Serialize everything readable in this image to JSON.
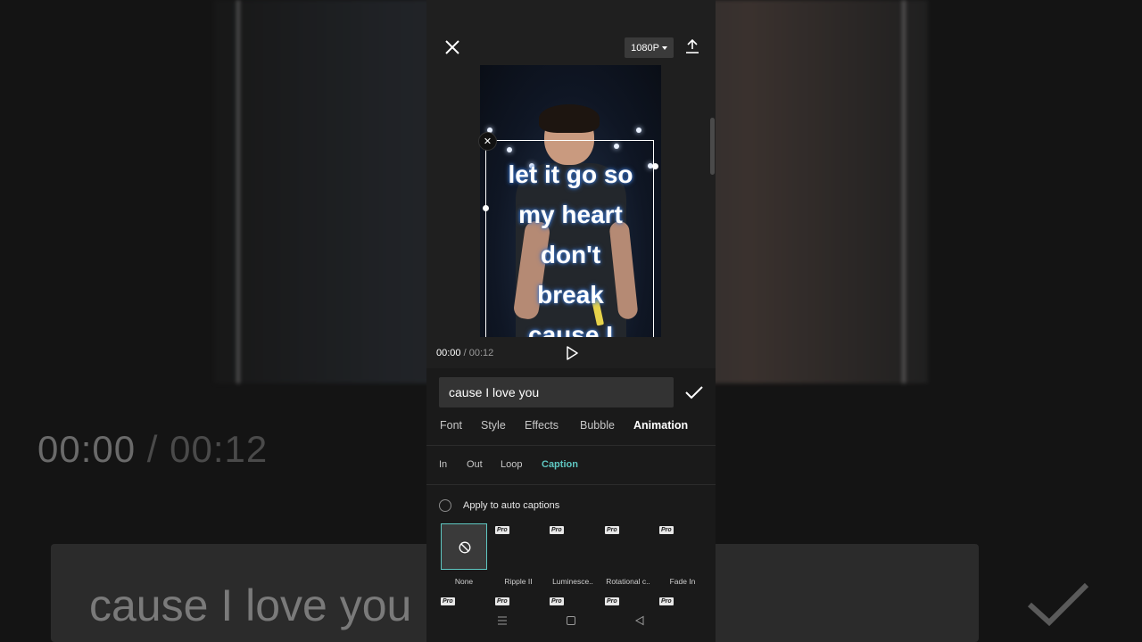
{
  "background": {
    "time_current": "00:00",
    "time_separator": "/",
    "time_total": "00:12",
    "input_text": "cause I love you"
  },
  "header": {
    "resolution": "1080P",
    "icons": [
      "close-icon",
      "export-icon"
    ]
  },
  "preview": {
    "caption": [
      "let it go so",
      "my heart",
      "don't",
      "break",
      "cause I"
    ]
  },
  "playback": {
    "current": "00:00",
    "separator": "/",
    "total": "00:12"
  },
  "editor": {
    "text_value": "cause I love you",
    "tabs": [
      "Font",
      "Style",
      "Effects",
      "Bubble",
      "Animation"
    ],
    "active_tab": "Animation",
    "subtabs": [
      "In",
      "Out",
      "Loop",
      "Caption"
    ],
    "active_subtab": "Caption",
    "apply_label": "Apply to auto captions",
    "pro_label": "Pro",
    "animations": [
      {
        "label": "None",
        "pro": false,
        "selected": true
      },
      {
        "label": "Ripple II",
        "pro": true
      },
      {
        "label": "Luminesce..",
        "pro": true
      },
      {
        "label": "Rotational c..",
        "pro": true
      },
      {
        "label": "Fade In",
        "pro": true
      }
    ]
  },
  "colors": {
    "accent": "#5fc7c2",
    "panel": "#1a1a1a",
    "caption_glow": "#3a73c8"
  }
}
